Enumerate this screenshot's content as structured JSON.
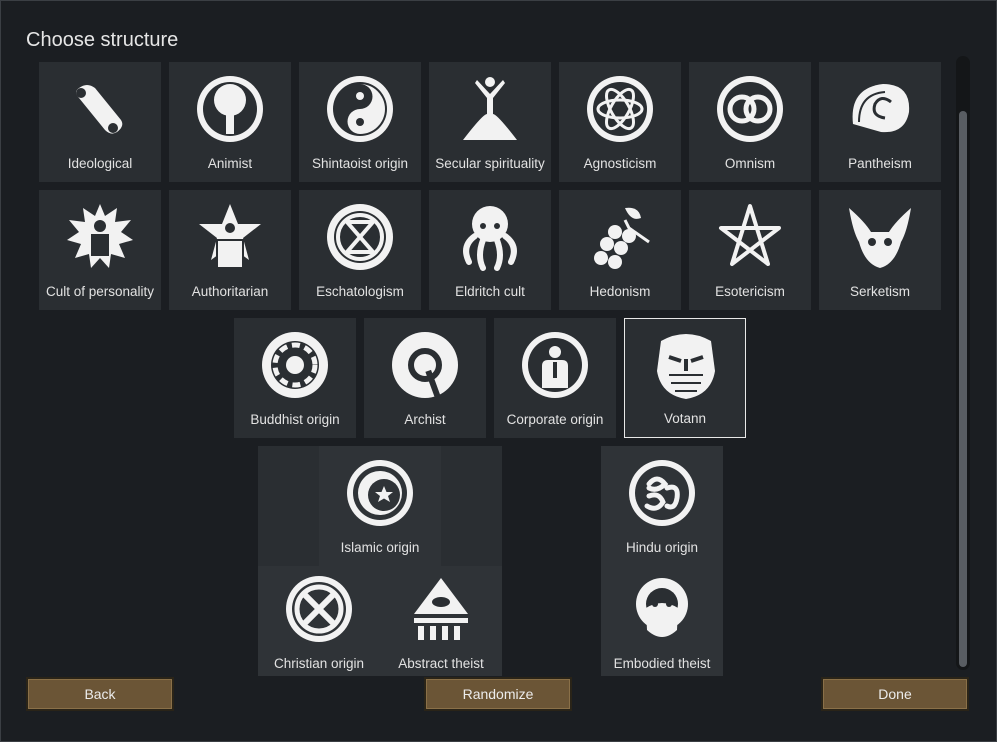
{
  "dialog": {
    "title": "Choose structure"
  },
  "tiles": {
    "ideological": "Ideological",
    "animist": "Animist",
    "shintaoist": "Shintaoist origin",
    "secular": "Secular spirituality",
    "agnosticism": "Agnosticism",
    "omnism": "Omnism",
    "pantheism": "Pantheism",
    "cult": "Cult of personality",
    "authoritarian": "Authoritarian",
    "eschatologism": "Eschatologism",
    "eldritch": "Eldritch cult",
    "hedonism": "Hedonism",
    "esotericism": "Esotericism",
    "serketism": "Serketism",
    "buddhist": "Buddhist origin",
    "archist": "Archist",
    "corporate": "Corporate origin",
    "votann": "Votann",
    "islamic": "Islamic origin",
    "hindu": "Hindu origin",
    "christian": "Christian origin",
    "abstract": "Abstract theist",
    "embodied": "Embodied theist"
  },
  "buttons": {
    "back": "Back",
    "randomize": "Randomize",
    "done": "Done"
  },
  "colors": {
    "button": "#6b5536",
    "tile": "#2a2e32",
    "selected_border": "#e8e8e8"
  }
}
